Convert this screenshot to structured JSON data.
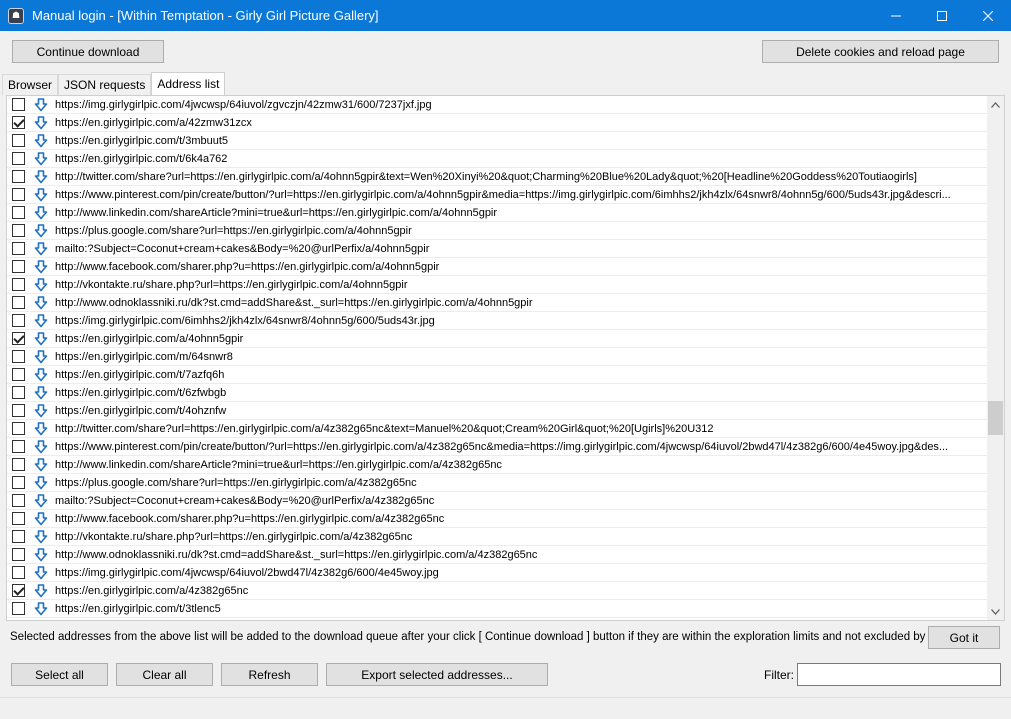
{
  "window": {
    "title": "Manual login - [Within Temptation - Girly Girl Picture Gallery]",
    "minimize": "—",
    "maximize": "☐",
    "close": "✕"
  },
  "toolbar": {
    "continue_label": "Continue download",
    "delete_label": "Delete cookies and reload page"
  },
  "tabs": [
    "Browser",
    "JSON requests",
    "Address list"
  ],
  "addresses": [
    {
      "url": "https://img.girlygirlpic.com/4jwcwsp/64iuvol/zgvczjn/42zmw31/600/7237jxf.jpg",
      "checked": false
    },
    {
      "url": "https://en.girlygirlpic.com/a/42zmw31zcx",
      "checked": true
    },
    {
      "url": "https://en.girlygirlpic.com/t/3mbuut5",
      "checked": false
    },
    {
      "url": "https://en.girlygirlpic.com/t/6k4a762",
      "checked": false
    },
    {
      "url": "http://twitter.com/share?url=https://en.girlygirlpic.com/a/4ohnn5gpir&text=Wen%20Xinyi%20&quot;Charming%20Blue%20Lady&quot;%20[Headline%20Goddess%20Toutiaogirls]",
      "checked": false
    },
    {
      "url": "https://www.pinterest.com/pin/create/button/?url=https://en.girlygirlpic.com/a/4ohnn5gpir&media=https://img.girlygirlpic.com/6imhhs2/jkh4zlx/64snwr8/4ohnn5g/600/5uds43r.jpg&descri...",
      "checked": false
    },
    {
      "url": "http://www.linkedin.com/shareArticle?mini=true&url=https://en.girlygirlpic.com/a/4ohnn5gpir",
      "checked": false
    },
    {
      "url": "https://plus.google.com/share?url=https://en.girlygirlpic.com/a/4ohnn5gpir",
      "checked": false
    },
    {
      "url": "mailto:?Subject=Coconut+cream+cakes&Body=%20@urlPerfix/a/4ohnn5gpir",
      "checked": false
    },
    {
      "url": "http://www.facebook.com/sharer.php?u=https://en.girlygirlpic.com/a/4ohnn5gpir",
      "checked": false
    },
    {
      "url": "http://vkontakte.ru/share.php?url=https://en.girlygirlpic.com/a/4ohnn5gpir",
      "checked": false
    },
    {
      "url": "http://www.odnoklassniki.ru/dk?st.cmd=addShare&st._surl=https://en.girlygirlpic.com/a/4ohnn5gpir",
      "checked": false
    },
    {
      "url": "https://img.girlygirlpic.com/6imhhs2/jkh4zlx/64snwr8/4ohnn5g/600/5uds43r.jpg",
      "checked": false
    },
    {
      "url": "https://en.girlygirlpic.com/a/4ohnn5gpir",
      "checked": true
    },
    {
      "url": "https://en.girlygirlpic.com/m/64snwr8",
      "checked": false
    },
    {
      "url": "https://en.girlygirlpic.com/t/7azfq6h",
      "checked": false
    },
    {
      "url": "https://en.girlygirlpic.com/t/6zfwbgb",
      "checked": false
    },
    {
      "url": "https://en.girlygirlpic.com/t/4ohznfw",
      "checked": false
    },
    {
      "url": "http://twitter.com/share?url=https://en.girlygirlpic.com/a/4z382g65nc&text=Manuel%20&quot;Cream%20Girl&quot;%20[Ugirls]%20U312",
      "checked": false
    },
    {
      "url": "https://www.pinterest.com/pin/create/button/?url=https://en.girlygirlpic.com/a/4z382g65nc&media=https://img.girlygirlpic.com/4jwcwsp/64iuvol/2bwd47l/4z382g6/600/4e45woy.jpg&des...",
      "checked": false
    },
    {
      "url": "http://www.linkedin.com/shareArticle?mini=true&url=https://en.girlygirlpic.com/a/4z382g65nc",
      "checked": false
    },
    {
      "url": "https://plus.google.com/share?url=https://en.girlygirlpic.com/a/4z382g65nc",
      "checked": false
    },
    {
      "url": "mailto:?Subject=Coconut+cream+cakes&Body=%20@urlPerfix/a/4z382g65nc",
      "checked": false
    },
    {
      "url": "http://www.facebook.com/sharer.php?u=https://en.girlygirlpic.com/a/4z382g65nc",
      "checked": false
    },
    {
      "url": "http://vkontakte.ru/share.php?url=https://en.girlygirlpic.com/a/4z382g65nc",
      "checked": false
    },
    {
      "url": "http://www.odnoklassniki.ru/dk?st.cmd=addShare&st._surl=https://en.girlygirlpic.com/a/4z382g65nc",
      "checked": false
    },
    {
      "url": "https://img.girlygirlpic.com/4jwcwsp/64iuvol/2bwd47l/4z382g6/600/4e45woy.jpg",
      "checked": false
    },
    {
      "url": "https://en.girlygirlpic.com/a/4z382g65nc",
      "checked": true
    },
    {
      "url": "https://en.girlygirlpic.com/t/3tlenc5",
      "checked": false
    }
  ],
  "info": {
    "text": "Selected addresses from the above list will be added to the download queue after your click [ Continue download ] button if they are within the exploration limits and not excluded by filters",
    "got_it_label": "Got it"
  },
  "bottom": {
    "select_all_label": "Select all",
    "clear_all_label": "Clear all",
    "refresh_label": "Refresh",
    "export_label": "Export selected addresses...",
    "filter_label": "Filter:",
    "filter_value": ""
  },
  "colors": {
    "titlebar": "#0b78d7",
    "download_arrow": "#1f6fc2"
  },
  "icons": {
    "download": "download-arrow-icon"
  }
}
